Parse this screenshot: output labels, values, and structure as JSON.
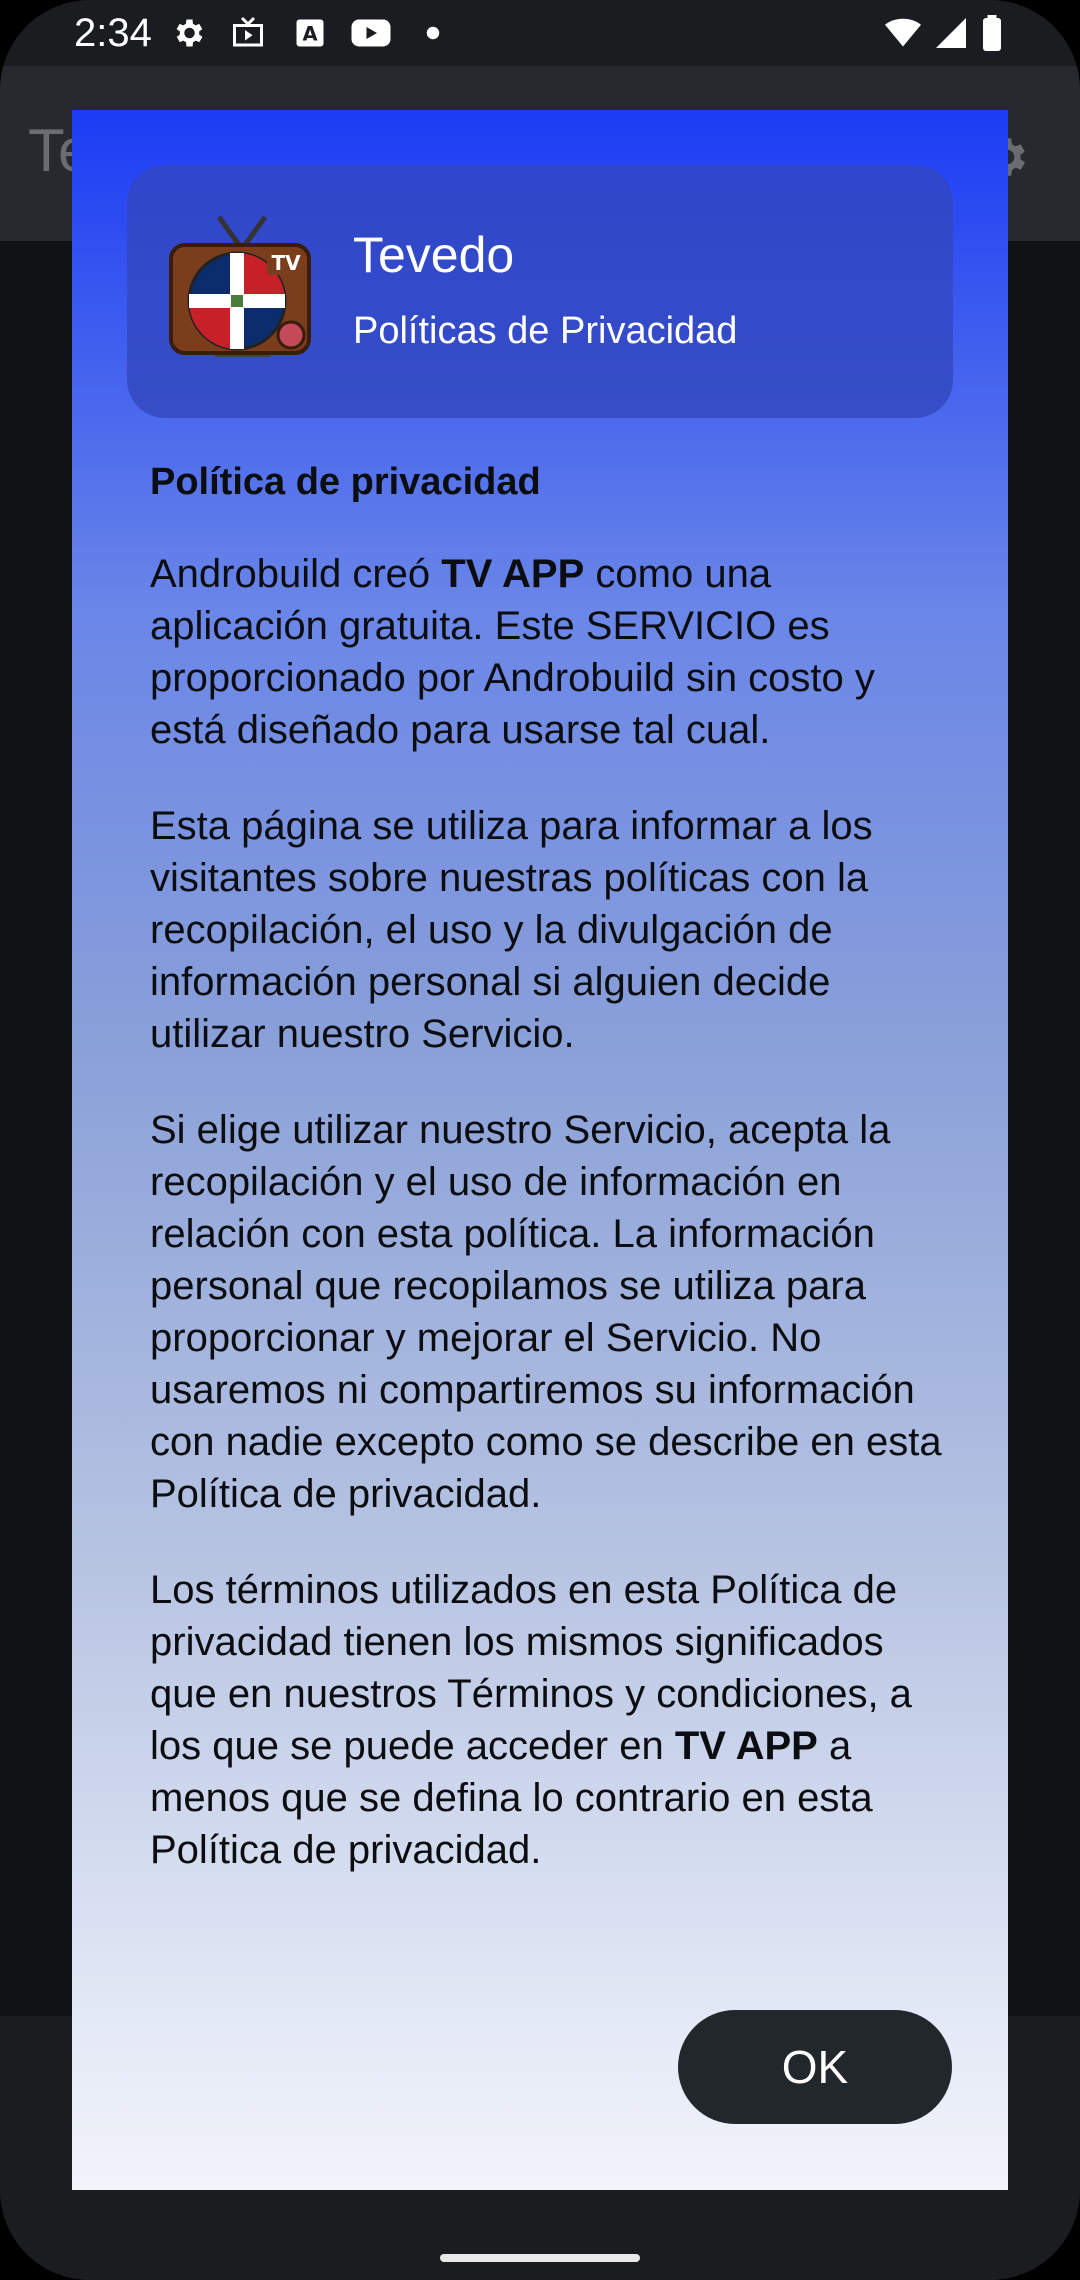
{
  "status_bar": {
    "time": "2:34",
    "left_icons": [
      "settings-icon",
      "tv-icon",
      "font-icon",
      "youtube-icon",
      "dot-icon"
    ],
    "right_icons": [
      "wifi-icon",
      "signal-icon",
      "battery-icon"
    ]
  },
  "background_app": {
    "title_partial": "Te"
  },
  "dialog": {
    "header": {
      "app_name": "Tevedo",
      "subtitle": "Políticas de Privacidad",
      "logo_badge": "TV"
    },
    "heading": "Política de privacidad",
    "paragraphs": [
      {
        "before": "Androbuild creó ",
        "bold": "TV APP",
        "after": " como una aplicación gratuita. Este SERVICIO es proporcionado por Androbuild sin costo y está diseñado para usarse tal cual."
      },
      {
        "text": "Esta página se utiliza para informar a los visitantes sobre nuestras políticas con la recopilación, el uso y la divulgación de información personal si alguien decide utilizar nuestro Servicio."
      },
      {
        "text": "Si elige utilizar nuestro Servicio, acepta la recopilación y el uso de información en relación con esta política. La información personal que recopilamos se utiliza para proporcionar y mejorar el Servicio. No usaremos ni compartiremos su información con nadie excepto como se describe en esta Política de privacidad."
      },
      {
        "before": "Los términos utilizados en esta Política de privacidad tienen los mismos significados que en nuestros Términos y condiciones, a los que se puede acceder en ",
        "bold": "TV APP",
        "after": " a menos que se defina lo contrario en esta Política de privacidad."
      }
    ],
    "ok_label": "OK"
  }
}
